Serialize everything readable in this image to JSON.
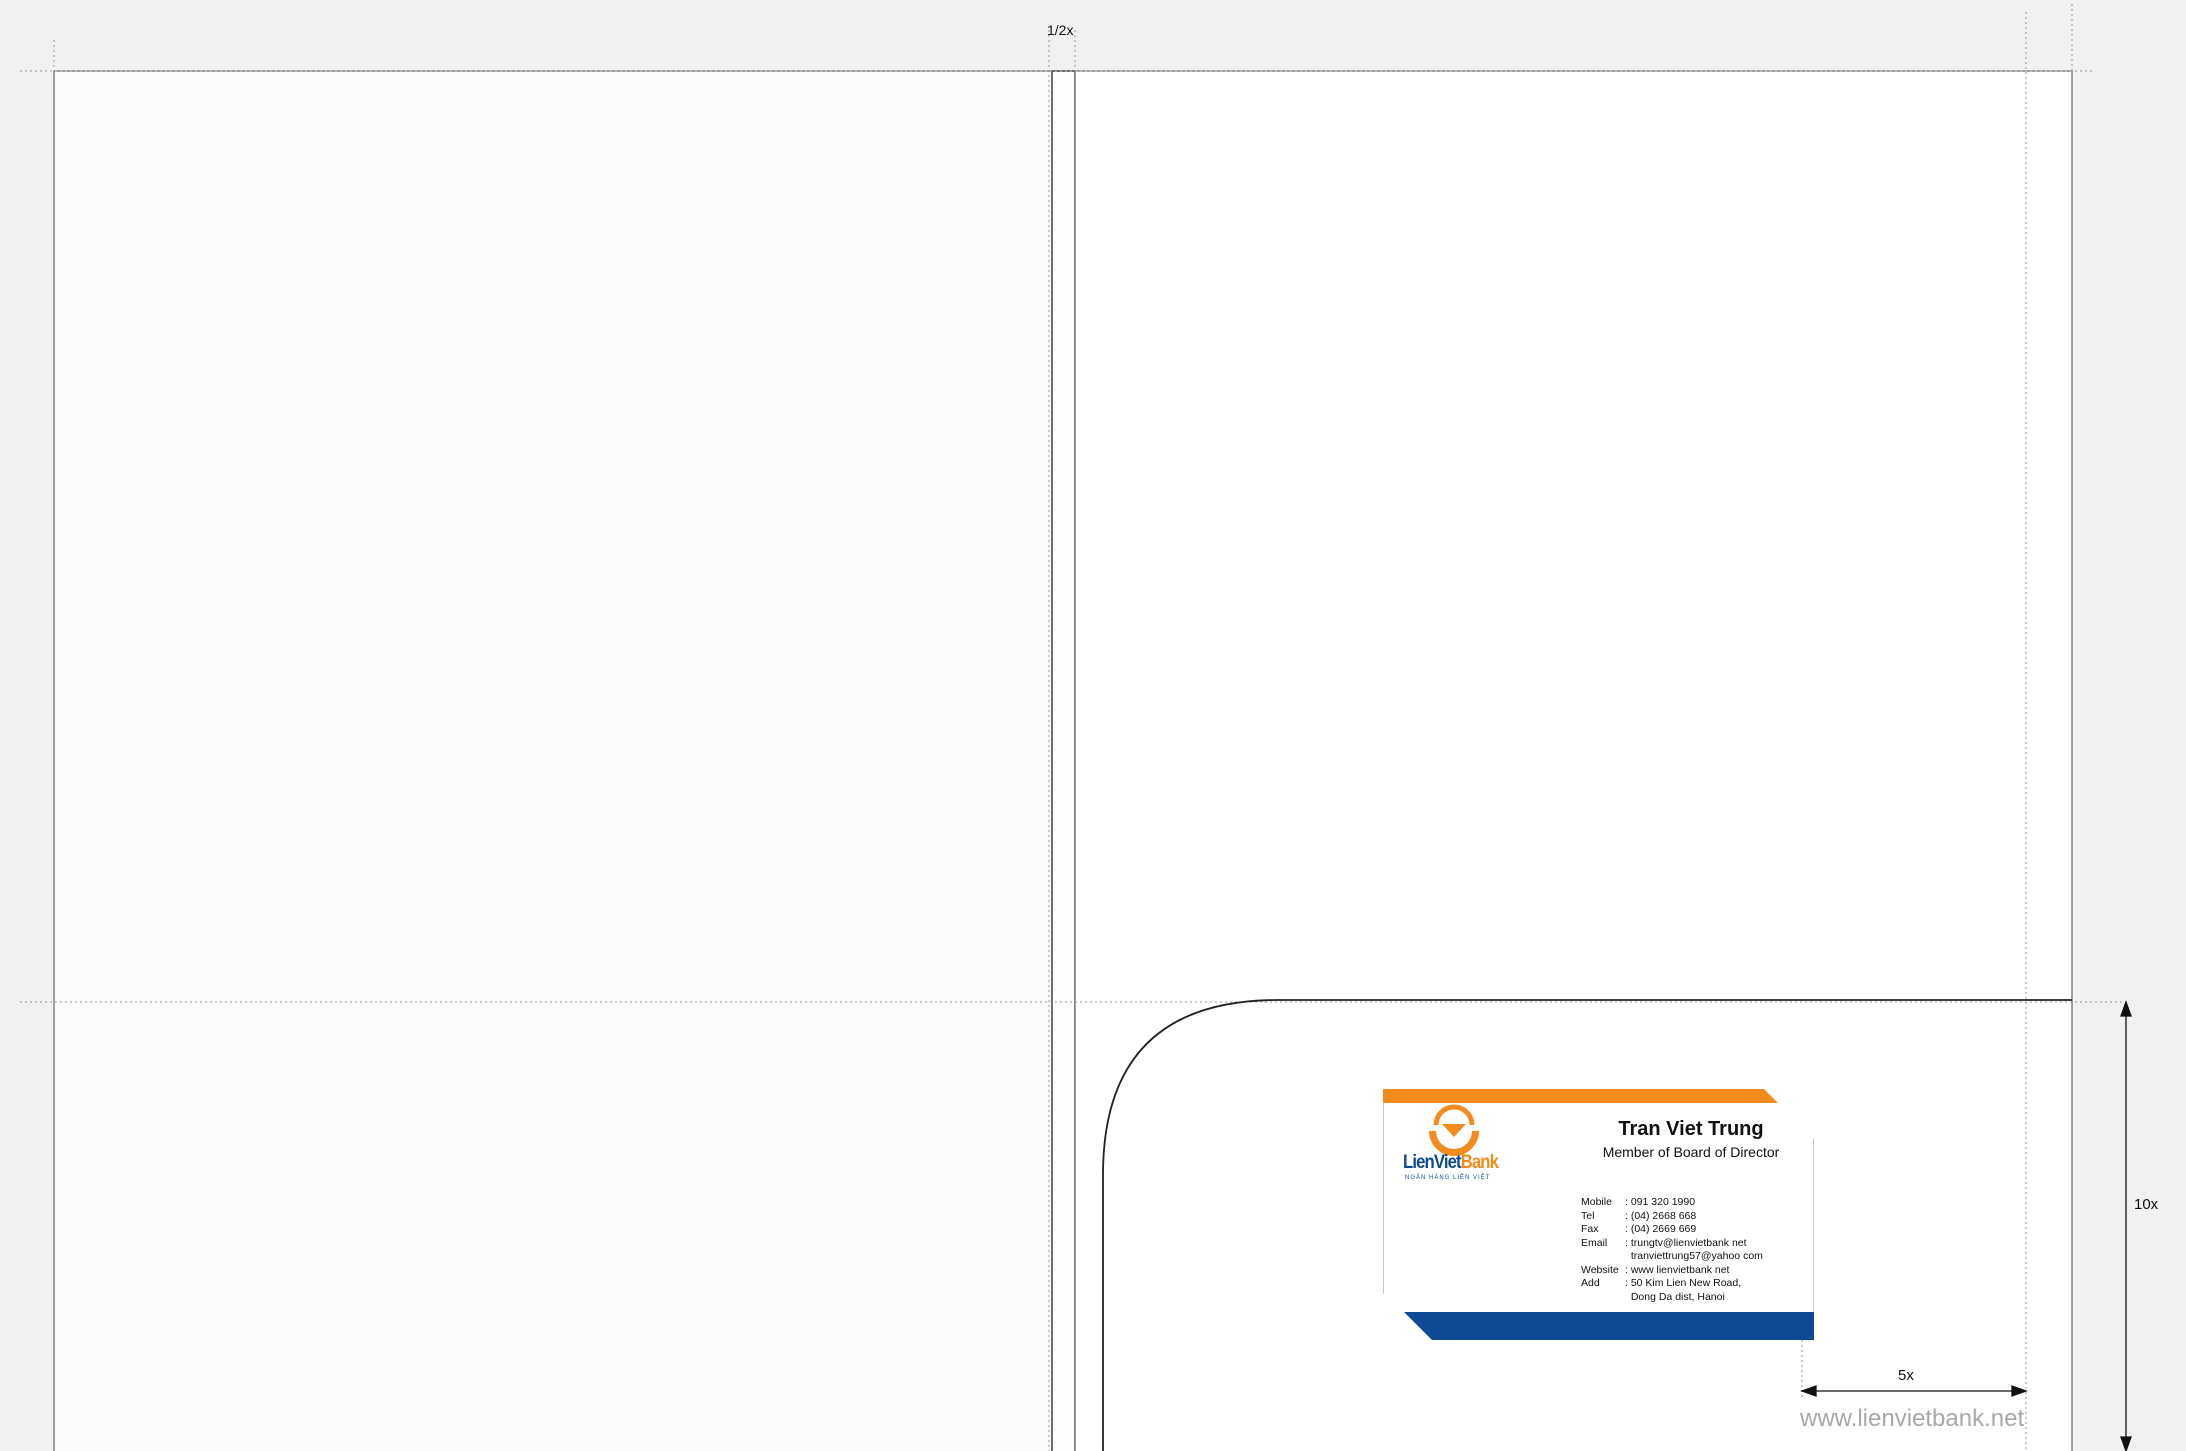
{
  "dimensions": {
    "top_gap": "1/2x",
    "right_height": "10x",
    "bottom_width": "5x"
  },
  "card": {
    "name": "Tran Viet Trung",
    "title": "Member of Board of Director",
    "logo": {
      "brand_part1": "LienViet",
      "brand_part2": "Bank",
      "tagline": "NGÂN HÀNG LIÊN VIỆT"
    },
    "contacts": [
      {
        "key": "Mobile",
        "value": ": 091 320 1990"
      },
      {
        "key": "Tel",
        "value": ": (04) 2668 668"
      },
      {
        "key": "Fax",
        "value": ": (04) 2669 669"
      },
      {
        "key": "Email",
        "value": ": trungtv@lienvietbank net"
      },
      {
        "key": "",
        "value": "  tranviettrung57@yahoo com"
      },
      {
        "key": "Website",
        "value": ": www lienvietbank net"
      },
      {
        "key": "Add",
        "value": ": 50 Kim Lien New Road,"
      },
      {
        "key": "",
        "value": "  Dong Da dist, Hanoi"
      }
    ],
    "colors": {
      "orange": "#f28c1e",
      "blue": "#0d4a91"
    }
  },
  "website": "www.lienvietbank.net"
}
